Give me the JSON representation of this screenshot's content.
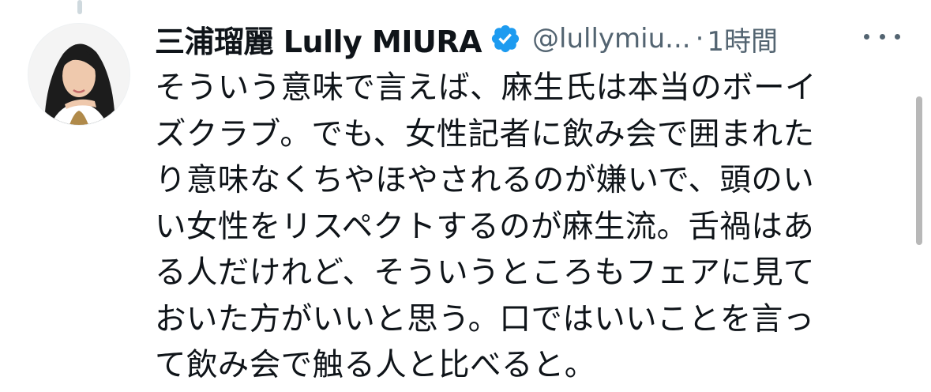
{
  "tweet": {
    "author_name": "三浦瑠麗 Lully MIURA",
    "handle": "@lullymiu...",
    "separator": "·",
    "timestamp": "1時間",
    "verified": true,
    "verified_icon": "verified-badge-icon",
    "more_icon": "more-horizontal-icon",
    "text_lines": [
      "そういう意味で言えば、麻生氏は本当のボーイ",
      "ズクラブ。でも、女性記者に飲み会で囲まれた",
      "り意味なくちやほやされるのが嫌いで、頭のい",
      "い女性をリスペクトするのが麻生流。舌禍はあ",
      "る人だけれど、そういうところもフェアに見て",
      "おいた方がいいと思う。口ではいいことを言っ",
      "て飲み会で触る人と比べると。"
    ]
  },
  "colors": {
    "text": "#0f1419",
    "secondary": "#536471",
    "verified": "#1d9bf0",
    "background": "#ffffff"
  }
}
